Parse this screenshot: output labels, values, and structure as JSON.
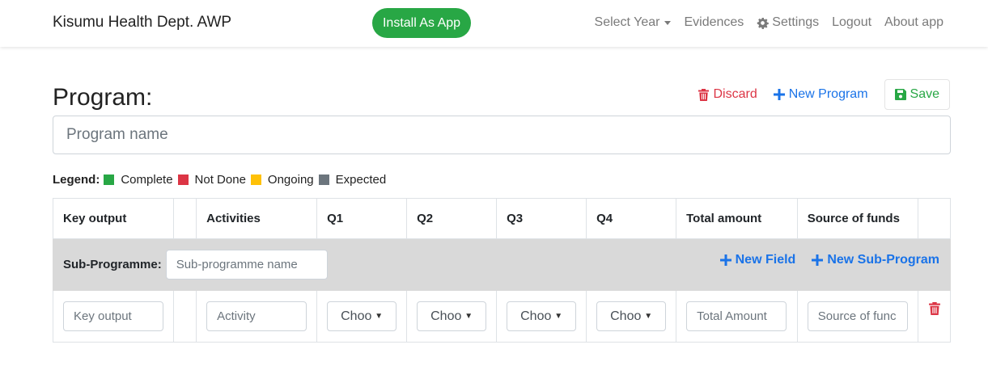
{
  "navbar": {
    "brand": "Kisumu Health Dept. AWP",
    "install_button": "Install As App",
    "links": {
      "select_year": "Select Year",
      "evidences": "Evidences",
      "settings": "Settings",
      "logout": "Logout",
      "about": "About app"
    }
  },
  "page": {
    "title": "Program:",
    "actions": {
      "discard": "Discard",
      "new_program": "New Program",
      "save": "Save"
    },
    "program_name_placeholder": "Program name"
  },
  "legend": {
    "title": "Legend:",
    "items": [
      {
        "label": "Complete",
        "color": "#28a745"
      },
      {
        "label": "Not Done",
        "color": "#dc3545"
      },
      {
        "label": "Ongoing",
        "color": "#ffc107"
      },
      {
        "label": "Expected",
        "color": "#6c757d"
      }
    ]
  },
  "table": {
    "headers": [
      "Key output",
      "",
      "Activities",
      "Q1",
      "Q2",
      "Q3",
      "Q4",
      "Total amount",
      "Source of funds",
      ""
    ],
    "sub_programme": {
      "label": "Sub-Programme:",
      "placeholder": "Sub-programme name",
      "new_field": "New Field",
      "new_sub_program": "New Sub-Program"
    },
    "row": {
      "key_output_placeholder": "Key output",
      "activity_placeholder": "Activity",
      "q1": "Choo",
      "q2": "Choo",
      "q3": "Choo",
      "q4": "Choo",
      "total_placeholder": "Total Amount",
      "source_placeholder": "Source of func"
    }
  },
  "colors": {
    "accent": "#1a73e8",
    "success": "#28a745",
    "danger": "#dc3545"
  }
}
